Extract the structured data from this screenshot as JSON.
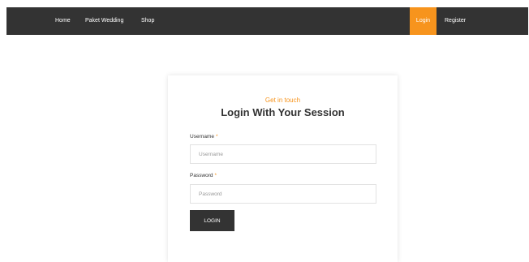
{
  "nav": {
    "home": "Home",
    "paket": "Paket Wedding",
    "shop": "Shop",
    "login": "Login",
    "register": "Register"
  },
  "form": {
    "eyebrow": "Get in touch",
    "title": "Login With Your Session",
    "username_label": "Username",
    "username_placeholder": "Username",
    "password_label": "Password",
    "password_placeholder": "Password",
    "required_marker": "*",
    "submit_label": "LOGIN"
  },
  "colors": {
    "accent": "#f7941d",
    "dark": "#333333"
  }
}
